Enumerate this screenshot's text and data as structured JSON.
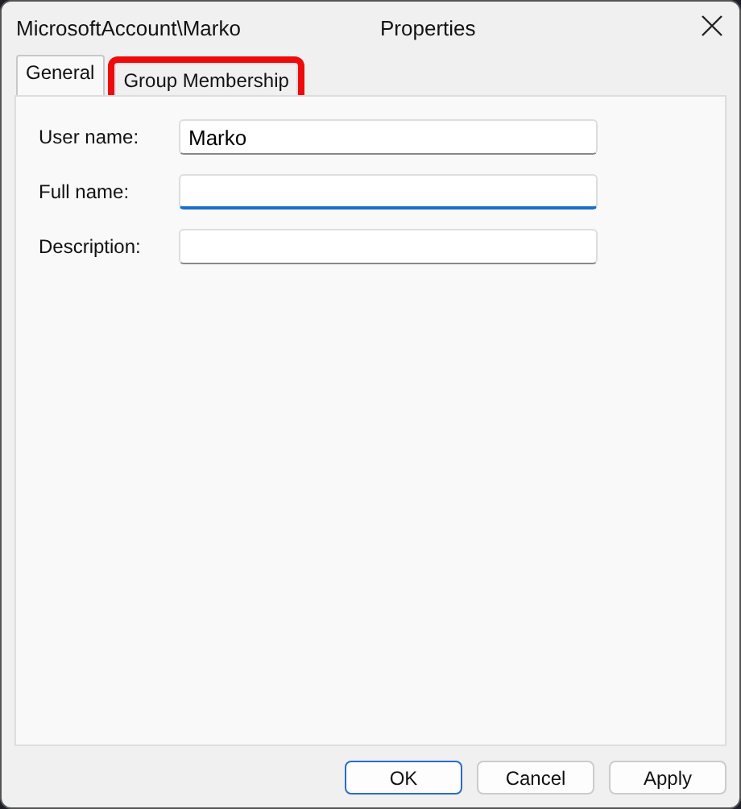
{
  "window": {
    "title_left": "MicrosoftAccount\\Marko",
    "title": "Properties"
  },
  "tabs": [
    {
      "label": "General",
      "selected": true,
      "highlighted": false
    },
    {
      "label": "Group Membership",
      "selected": false,
      "highlighted": true
    }
  ],
  "fields": [
    {
      "label": "User name:",
      "value": "Marko",
      "focused": false
    },
    {
      "label": "Full name:",
      "focused": true
    },
    {
      "label": "Description:",
      "focused": false
    }
  ],
  "buttons": [
    {
      "label": "OK",
      "default": true
    },
    {
      "label": "Cancel",
      "default": false
    },
    {
      "label": "Apply",
      "default": false
    }
  ]
}
